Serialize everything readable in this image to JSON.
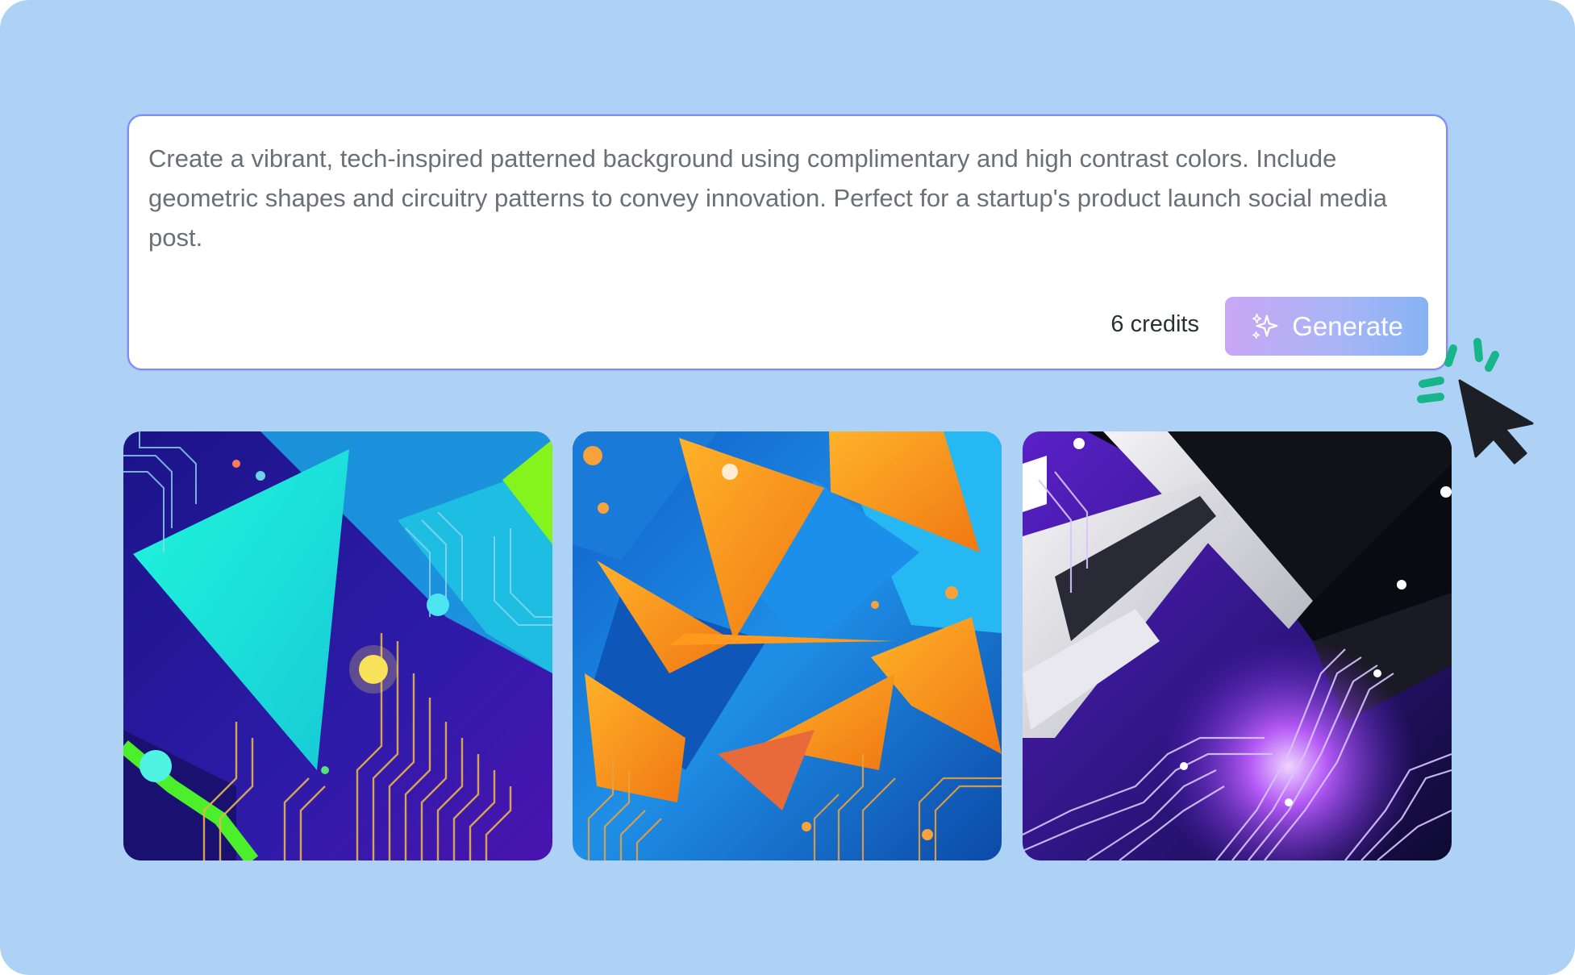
{
  "prompt": {
    "text": "Create a vibrant, tech-inspired patterned background using complimentary and high contrast colors. Include geometric shapes and circuitry patterns to convey innovation. Perfect for a startup's product launch social media post."
  },
  "actions": {
    "credits_label": "6 credits",
    "generate_label": "Generate",
    "generate_icon": "sparkles-icon"
  },
  "results": [
    {
      "name": "generated-image-1",
      "palette": [
        "#2a1a9c",
        "#19e3d0",
        "#7cf21c",
        "#f2d15a"
      ]
    },
    {
      "name": "generated-image-2",
      "palette": [
        "#1e86e0",
        "#f39a1a",
        "#26b6f0",
        "#0d3d86"
      ]
    },
    {
      "name": "generated-image-3",
      "palette": [
        "#14103a",
        "#8b3ff0",
        "#e6e6ea",
        "#000000"
      ]
    }
  ],
  "colors": {
    "background": "#aed2f5",
    "accent_burst": "#17b58a",
    "cursor": "#1c2026"
  }
}
